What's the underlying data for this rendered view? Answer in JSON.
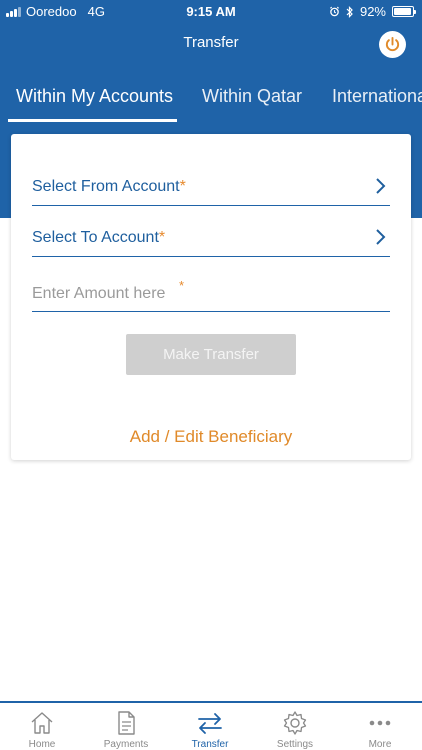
{
  "status_bar": {
    "carrier": "Ooredoo",
    "network": "4G",
    "time": "9:15 AM",
    "battery": "92%",
    "battery_level": 0.92
  },
  "header": {
    "title": "Transfer",
    "power_icon": "power-icon"
  },
  "tabs": [
    {
      "label": "Within My Accounts",
      "active": true
    },
    {
      "label": "Within Qatar",
      "active": false
    },
    {
      "label": "International",
      "active": false
    }
  ],
  "form": {
    "from_account_label": "Select From Account",
    "to_account_label": "Select To Account",
    "amount_placeholder": "Enter Amount here",
    "amount_value": "",
    "required_marker": "*",
    "submit_label": "Make Transfer",
    "beneficiary_link": "Add / Edit Beneficiary"
  },
  "bottom_nav": [
    {
      "label": "Home",
      "icon": "home-icon",
      "active": false
    },
    {
      "label": "Payments",
      "icon": "document-icon",
      "active": false
    },
    {
      "label": "Transfer",
      "icon": "transfer-arrows-icon",
      "active": true
    },
    {
      "label": "Settings",
      "icon": "gear-icon",
      "active": false
    },
    {
      "label": "More",
      "icon": "more-dots-icon",
      "active": false
    }
  ],
  "colors": {
    "brand_blue": "#1f63a8",
    "accent_orange": "#e08a2a",
    "disabled_button": "#cfcfcf"
  }
}
